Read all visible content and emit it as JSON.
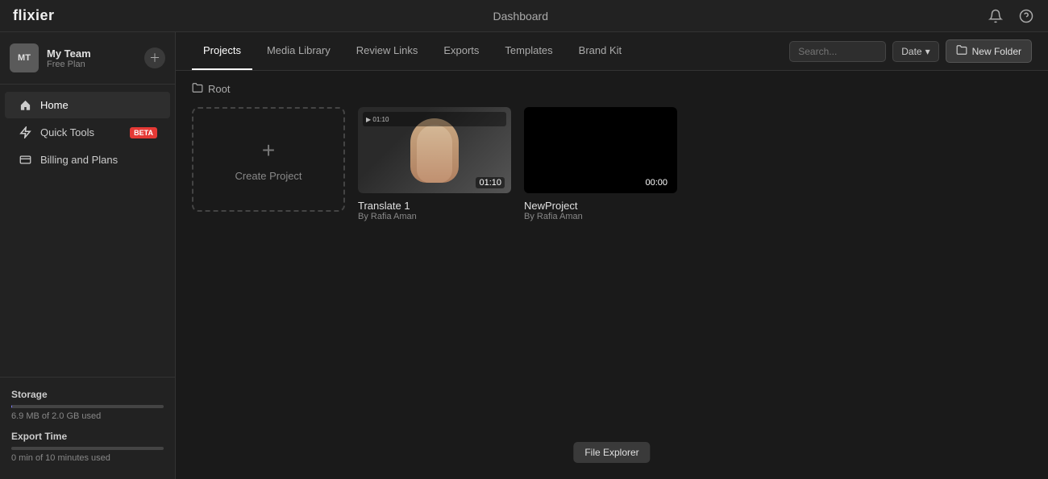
{
  "app": {
    "logo": "flixier",
    "topbar_title": "Dashboard"
  },
  "topbar": {
    "bell_icon": "🔔",
    "help_icon": "?",
    "notification_label": "notifications",
    "help_label": "help"
  },
  "sidebar": {
    "team": {
      "avatar": "MT",
      "name": "My Team",
      "plan": "Free Plan",
      "settings_icon": "+"
    },
    "nav": [
      {
        "id": "home",
        "icon": "⌂",
        "label": "Home",
        "active": true
      },
      {
        "id": "quick-tools",
        "icon": "⚡",
        "label": "Quick Tools",
        "badge": "beta"
      },
      {
        "id": "billing",
        "icon": "▤",
        "label": "Billing and Plans"
      }
    ],
    "storage": {
      "label": "Storage",
      "used_text": "6.9 MB of 2.0 GB used",
      "fill_percent": 0.4
    },
    "export_time": {
      "label": "Export Time",
      "used_text": "0 min of 10 minutes used",
      "fill_percent": 0
    }
  },
  "tabs": [
    {
      "id": "projects",
      "label": "Projects",
      "active": true
    },
    {
      "id": "media-library",
      "label": "Media Library"
    },
    {
      "id": "review-links",
      "label": "Review Links"
    },
    {
      "id": "exports",
      "label": "Exports"
    },
    {
      "id": "templates",
      "label": "Templates"
    },
    {
      "id": "brand-kit",
      "label": "Brand Kit"
    }
  ],
  "toolbar": {
    "search_placeholder": "Search...",
    "date_label": "Date",
    "new_folder_label": "New Folder",
    "folder_icon": "📁"
  },
  "breadcrumb": {
    "icon": "📁",
    "label": "Root"
  },
  "projects": [
    {
      "id": "create",
      "type": "create",
      "label": "Create Project"
    },
    {
      "id": "translate1",
      "type": "project",
      "title": "Translate 1",
      "author": "By Rafia Aman",
      "duration": "01:10",
      "has_thumbnail": true
    },
    {
      "id": "newproject",
      "type": "project",
      "title": "NewProject",
      "author": "By Rafia Aman",
      "duration": "00:00",
      "has_thumbnail": false
    }
  ],
  "file_explorer": {
    "label": "File Explorer"
  }
}
